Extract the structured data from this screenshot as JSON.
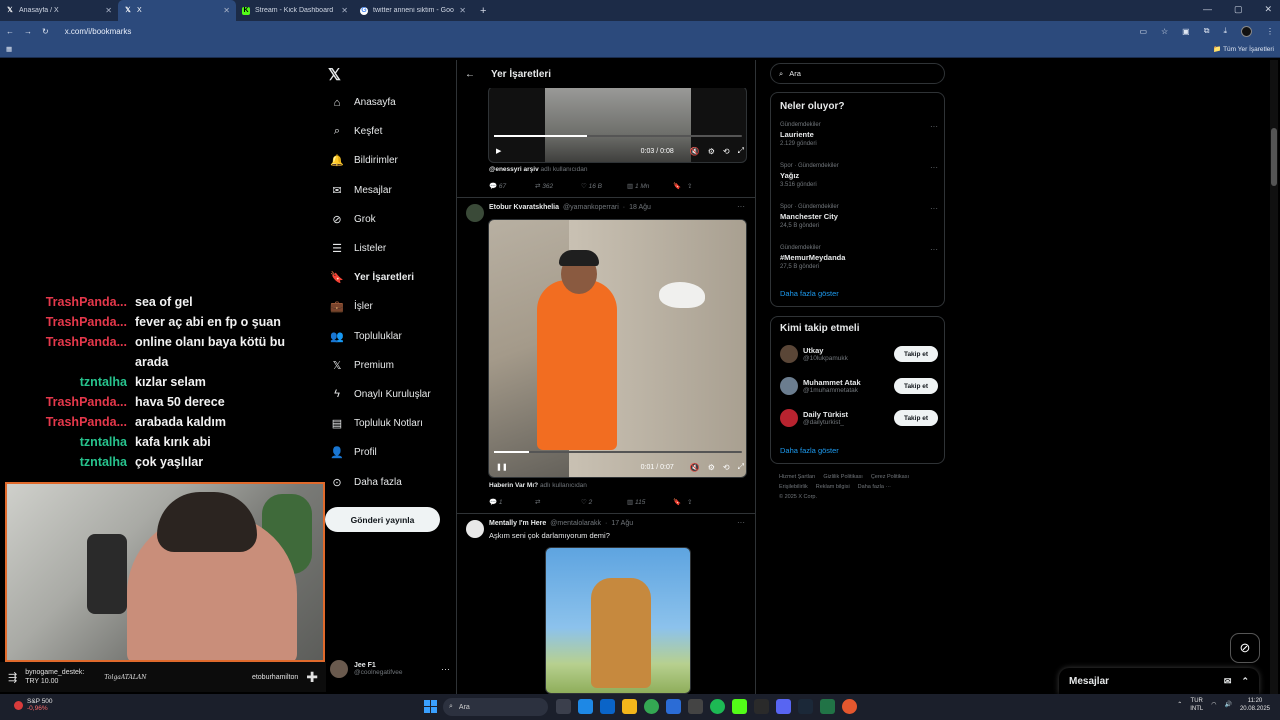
{
  "browser": {
    "tabs": [
      {
        "label": "Anasayfa / X",
        "icon": "x-logo-icon",
        "active": false
      },
      {
        "label": "X",
        "icon": "x-logo-icon",
        "active": true
      },
      {
        "label": "Stream - Kick Dashboard",
        "icon": "kick-icon",
        "active": false
      },
      {
        "label": "twitter anneni siktim - Google'",
        "icon": "google-icon",
        "active": false
      }
    ],
    "url": "x.com/i/bookmarks",
    "bookmarks_folder": "Tüm Yer İşaretleri",
    "accent": "#2c4a7c"
  },
  "sidebar": {
    "nav": [
      {
        "label": "Anasayfa",
        "icon": "home-icon"
      },
      {
        "label": "Keşfet",
        "icon": "search-icon"
      },
      {
        "label": "Bildirimler",
        "icon": "bell-icon"
      },
      {
        "label": "Mesajlar",
        "icon": "mail-icon"
      },
      {
        "label": "Grok",
        "icon": "grok-icon"
      },
      {
        "label": "Listeler",
        "icon": "list-icon"
      },
      {
        "label": "Yer İşaretleri",
        "icon": "bookmark-icon",
        "active": true
      },
      {
        "label": "İşler",
        "icon": "briefcase-icon"
      },
      {
        "label": "Topluluklar",
        "icon": "people-icon"
      },
      {
        "label": "Premium",
        "icon": "x-logo-icon"
      },
      {
        "label": "Onaylı Kuruluşlar",
        "icon": "lightning-icon"
      },
      {
        "label": "Topluluk Notları",
        "icon": "notes-icon"
      },
      {
        "label": "Profil",
        "icon": "person-icon"
      },
      {
        "label": "Daha fazla",
        "icon": "more-circle-icon"
      }
    ],
    "post_button": "Gönderi yayınla",
    "account": {
      "name": "Jee F1",
      "handle": "@coolnegatifvee"
    }
  },
  "chat": [
    {
      "user": "",
      "msg": "",
      "color": "red"
    },
    {
      "user": "TrashPanda...",
      "msg": "sea of gel",
      "color": "red"
    },
    {
      "user": "TrashPanda...",
      "msg": "fever aç abi en fp o şuan",
      "color": "red"
    },
    {
      "user": "TrashPanda...",
      "msg": "online olanı baya kötü bu arada",
      "color": "red"
    },
    {
      "user": "tzntalha",
      "msg": "kızlar selam",
      "color": "green"
    },
    {
      "user": "TrashPanda...",
      "msg": "hava 50 derece",
      "color": "red"
    },
    {
      "user": "TrashPanda...",
      "msg": "arabada kaldım",
      "color": "red"
    },
    {
      "user": "tzntalha",
      "msg": "kafa kırık abi",
      "color": "green"
    },
    {
      "user": "tzntalha",
      "msg": "çok yaşlılar",
      "color": "green"
    }
  ],
  "ticker": {
    "line1": "bynogame_destek:",
    "line2": "TRY 10.00",
    "signature": "TolgaATALAN",
    "name": "etoburhamilton"
  },
  "main": {
    "header_title": "Yer İşaretleri",
    "post1": {
      "video_time": "0:03 / 0:08",
      "progress": 0.375,
      "attribution_user": "@enessyri arşiv",
      "attribution_text": "adlı kullanıcıdan",
      "stats": {
        "replies": "67",
        "reposts": "362",
        "likes": "16 B",
        "views": "1 Mn"
      }
    },
    "post2": {
      "name": "Etobur Kvaratskhelia",
      "handle": "@yamankoperrari",
      "date": "18 Ağu",
      "video_time": "0:01 / 0:07",
      "progress": 0.14,
      "attribution_user": "Haberin Var Mı?",
      "attribution_text": "adlı kullanıcıdan",
      "stats": {
        "replies": "1",
        "reposts": "",
        "likes": "2",
        "views": "115"
      }
    },
    "post3": {
      "name": "Mentally I'm Here",
      "handle": "@mentalolarakk",
      "date": "17 Ağu",
      "text": "Aşkım seni çok darlamıyorum demi?"
    }
  },
  "right": {
    "search_placeholder": "Ara",
    "trends_title": "Neler oluyor?",
    "trends": [
      {
        "category": "Gündemdekiler",
        "name": "Lauriente",
        "posts": "2.129 gönderi"
      },
      {
        "category": "Spor · Gündemdekiler",
        "name": "Yağız",
        "posts": "3.516 gönderi"
      },
      {
        "category": "Spor · Gündemdekiler",
        "name": "Manchester City",
        "posts": "24,5 B gönderi"
      },
      {
        "category": "Gündemdekiler",
        "name": "#MemurMeydanda",
        "posts": "27,5 B gönderi"
      }
    ],
    "show_more": "Daha fazla göster",
    "who_title": "Kimi takip etmeli",
    "who": [
      {
        "name": "Utkay",
        "handle": "@10lukpamukk",
        "button": "Takip et"
      },
      {
        "name": "Muhammet Atak",
        "handle": "@1muhammetatak",
        "button": "Takip et"
      },
      {
        "name": "Daily Türkist",
        "handle": "@dailyturkist_",
        "button": "Takip et"
      }
    ],
    "who_show_more": "Daha fazla göster",
    "footer": [
      "Hizmet Şartları",
      "Gizlilik Politikası",
      "Çerez Politikası",
      "Erişilebilirlik",
      "Reklam bilgisi",
      "Daha fazla ···",
      "© 2025 X Corp."
    ],
    "messages_title": "Mesajlar"
  },
  "taskbar": {
    "stock_name": "S&P 500",
    "stock_change": "-0,96%",
    "search": "Ara",
    "lang": "TUR",
    "layout": "INTL",
    "time": "11:20",
    "date": "20.08.2025"
  }
}
